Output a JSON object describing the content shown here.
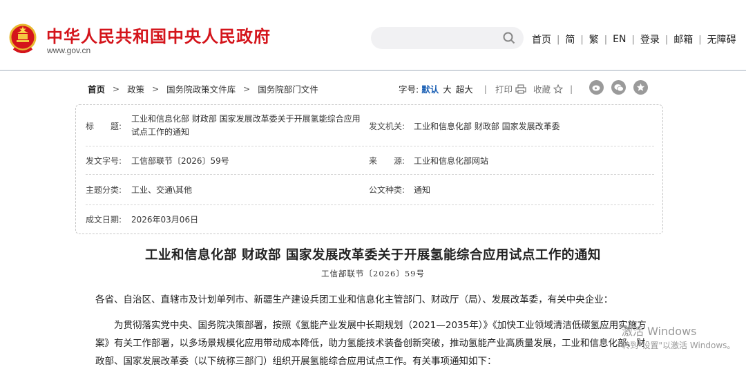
{
  "header": {
    "site_title": "中华人民共和国中央人民政府",
    "site_url": "www.gov.cn",
    "search_placeholder": "",
    "nav": [
      "首页",
      "简",
      "繁",
      "EN",
      "登录",
      "邮箱",
      "无障碍"
    ]
  },
  "breadcrumb": {
    "items": [
      "首页",
      "政策",
      "国务院政策文件库",
      "国务院部门文件"
    ]
  },
  "tools": {
    "font_label": "字号:",
    "sizes": [
      "默认",
      "大",
      "超大"
    ],
    "print": "打印",
    "favorite": "收藏",
    "share_icons": [
      "weibo-icon",
      "wechat-icon",
      "star-icon"
    ]
  },
  "info": {
    "title_key": "标　　题:",
    "title_value_line1": "工业和信息化部 财政部 国家发展改革委关于开展氢能综合应用",
    "title_value_line2": "试点工作的通知",
    "issuer_key": "发文机关:",
    "issuer_value": "工业和信息化部 财政部 国家发展改革委",
    "docno_key": "发文字号:",
    "docno_value": "工信部联节〔2026〕59号",
    "source_key": "来　　源:",
    "source_value": "工业和信息化部网站",
    "topic_key": "主题分类:",
    "topic_value": "工业、交通\\其他",
    "doctype_key": "公文种类:",
    "doctype_value": "通知",
    "date_key": "成文日期:",
    "date_value": "2026年03月06日"
  },
  "article": {
    "title": "工业和信息化部 财政部 国家发展改革委关于开展氢能综合应用试点工作的通知",
    "doc_no": "工信部联节〔2026〕59号",
    "para1": "各省、自治区、直辖市及计划单列市、新疆生产建设兵团工业和信息化主管部门、财政厅（局）、发展改革委，有关中央企业：",
    "para2": "为贯彻落实党中央、国务院决策部署，按照《氢能产业发展中长期规划（2021—2035年）》《加快工业领域清洁低碳氢应用实施方案》有关工作部署，以多场景规模化应用带动成本降低，助力氢能技术装备创新突破，推动氢能产业高质量发展，工业和信息化部、财政部、国家发展改革委（以下统称三部门）组织开展氢能综合应用试点工作。有关事项通知如下："
  },
  "watermark": {
    "line1": "激活 Windows",
    "line2": "转到\"设置\"以激活 Windows。"
  },
  "colors": {
    "brand_red": "#d4141b",
    "active_blue": "#1a5fb4"
  }
}
